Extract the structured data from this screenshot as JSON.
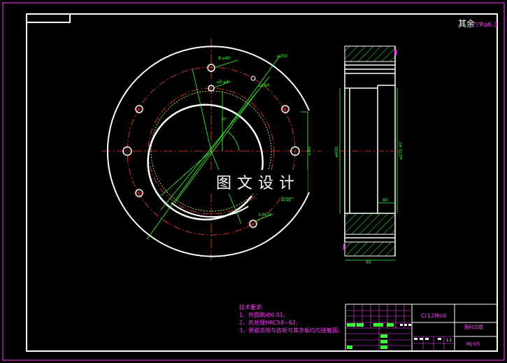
{
  "corner_note": {
    "text": "其余",
    "symbol": "▽Ra6.3"
  },
  "banner": {
    "text": "图文设计"
  },
  "front_view": {
    "labels": {
      "hole_top": "8-⌀40",
      "hole_small": "⌀5-⌀4",
      "dia_250": "⌀250",
      "dia_180": "⌀180",
      "ang_30": "30°",
      "dia_390": "⌀390",
      "hole_bottom": "3-M10",
      "len_48": "4×48"
    }
  },
  "side_view": {
    "labels": {
      "dia_left": "⌀430",
      "dia_right": "⌀270 H7",
      "len_80": "80",
      "len_60": "60"
    }
  },
  "tech_notes": {
    "title": "技术要求:",
    "items": [
      "1、外圆跳动0.01;",
      "2、热处理HRC58~62;",
      "3、退磁去除与齿轮与其余板均匀接触面;"
    ]
  },
  "title_block": {
    "material": "Cr12MoV",
    "part_name": "落料凹模",
    "drawing_no": "MJ-05",
    "scale": "1:1"
  }
}
